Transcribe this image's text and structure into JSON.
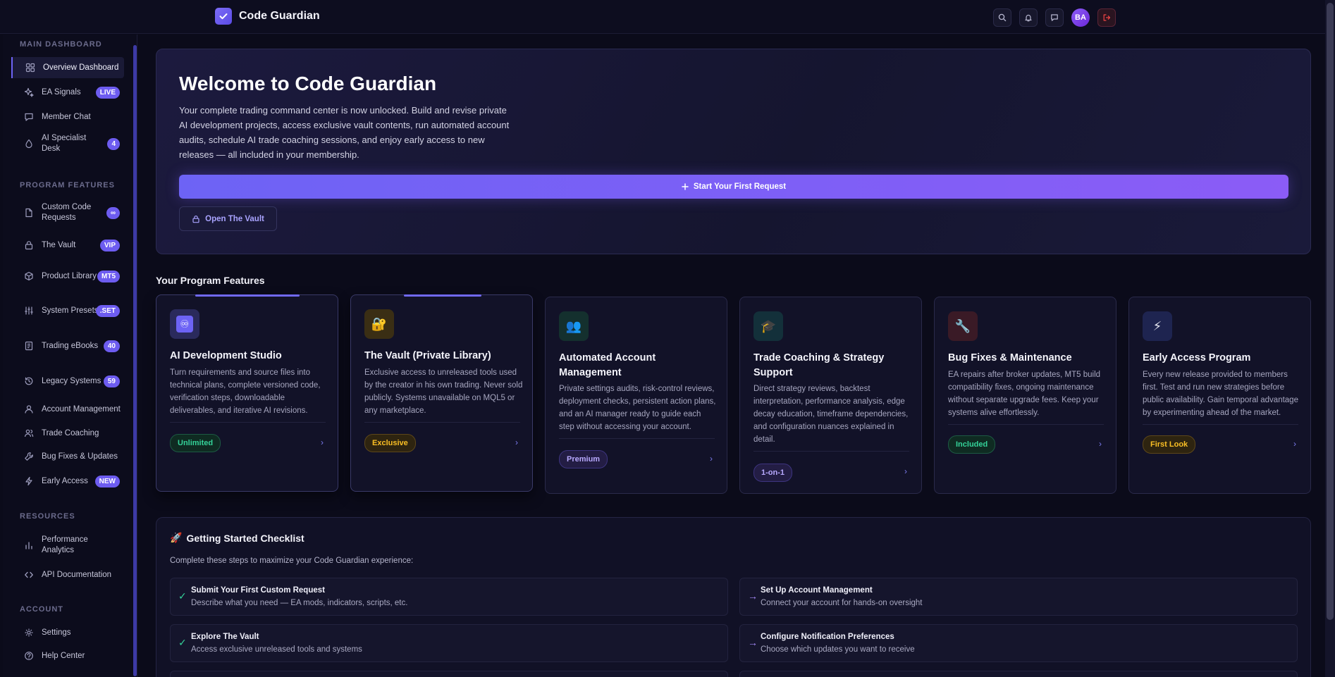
{
  "brand": {
    "name": "Code Guardian"
  },
  "header": {
    "avatar_initials": "BA"
  },
  "sidebar": {
    "sections": {
      "main": "MAIN DASHBOARD",
      "program": "PROGRAM FEATURES",
      "resources": "RESOURCES",
      "account": "ACCOUNT"
    },
    "items": {
      "overview": {
        "label": "Overview Dashboard"
      },
      "signals": {
        "label": "EA Signals",
        "badge": "LIVE"
      },
      "chat": {
        "label": "Member Chat"
      },
      "specialist": {
        "label": "AI Specialist Desk",
        "badge": "4"
      },
      "custom": {
        "label": "Custom Code Requests",
        "badge": "∞"
      },
      "vault": {
        "label": "The Vault",
        "badge": "VIP"
      },
      "product": {
        "label": "Product Library",
        "badge": "MT5"
      },
      "presets": {
        "label": "System Presets",
        "badge": ".SET"
      },
      "ebooks": {
        "label": "Trading eBooks",
        "badge": "40"
      },
      "legacy": {
        "label": "Legacy Systems",
        "badge": "59"
      },
      "account_mgmt": {
        "label": "Account Management"
      },
      "coaching": {
        "label": "Trade Coaching"
      },
      "bugfixes": {
        "label": "Bug Fixes & Updates"
      },
      "early": {
        "label": "Early Access",
        "badge": "NEW"
      },
      "performance": {
        "label": "Performance Analytics"
      },
      "api": {
        "label": "API Documentation"
      },
      "settings": {
        "label": "Settings"
      },
      "help": {
        "label": "Help Center"
      }
    }
  },
  "hero": {
    "title": "Welcome to Code Guardian",
    "description": "Your complete trading command center is now unlocked. Build and revise private AI development projects, access exclusive vault contents, run automated account audits, schedule AI trade coaching sessions, and enjoy early access to new releases — all included in your membership.",
    "primary_button": "Start Your First Request",
    "secondary_button": "Open The Vault"
  },
  "features": {
    "title": "Your Program Features",
    "cards": [
      {
        "icon": "♾",
        "title": "AI Development Studio",
        "description": "Turn requirements and source files into technical plans, complete versioned code, verification steps, downloadable deliverables, and iterative AI revisions.",
        "badge": "Unlimited"
      },
      {
        "icon": "🔐",
        "title": "The Vault (Private Library)",
        "description": "Exclusive access to unreleased tools used by the creator in his own trading. Never sold publicly. Systems unavailable on MQL5 or any marketplace.",
        "badge": "Exclusive"
      },
      {
        "icon": "👥",
        "title": "Automated Account Management",
        "description": "Private settings audits, risk-control reviews, deployment checks, persistent action plans, and an AI manager ready to guide each step without accessing your account.",
        "badge": "Premium"
      },
      {
        "icon": "🎓",
        "title": "Trade Coaching & Strategy Support",
        "description": "Direct strategy reviews, backtest interpretation, performance analysis, edge decay education, timeframe dependencies, and configuration nuances explained in detail.",
        "badge": "1-on-1"
      },
      {
        "icon": "🔧",
        "title": "Bug Fixes & Maintenance",
        "description": "EA repairs after broker updates, MT5 build compatibility fixes, ongoing maintenance without separate upgrade fees. Keep your systems alive effortlessly.",
        "badge": "Included"
      },
      {
        "icon": "⚡",
        "title": "Early Access Program",
        "description": "Every new release provided to members first. Test and run new strategies before public availability. Gain temporal advantage by experimenting ahead of the market.",
        "badge": "First Look"
      }
    ]
  },
  "checklist": {
    "emoji": "🚀",
    "title": "Getting Started Checklist",
    "subtitle": "Complete these steps to maximize your Code Guardian experience:",
    "items": [
      {
        "mark": "✓",
        "title": "Submit Your First Custom Request",
        "description": "Describe what you need — EA mods, indicators, scripts, etc."
      },
      {
        "mark": "→",
        "title": "Set Up Account Management",
        "description": "Connect your account for hands-on oversight"
      },
      {
        "mark": "✓",
        "title": "Explore The Vault",
        "description": "Access exclusive unreleased tools and systems"
      },
      {
        "mark": "→",
        "title": "Configure Notification Preferences",
        "description": "Choose which updates you want to receive"
      }
    ]
  },
  "colors": {
    "accent": "#6d63f5",
    "accent_2": "#8b5cf6",
    "background": "#0b0b1a",
    "success": "#34d399",
    "warning": "#fbbf24",
    "danger": "#ef4444"
  }
}
